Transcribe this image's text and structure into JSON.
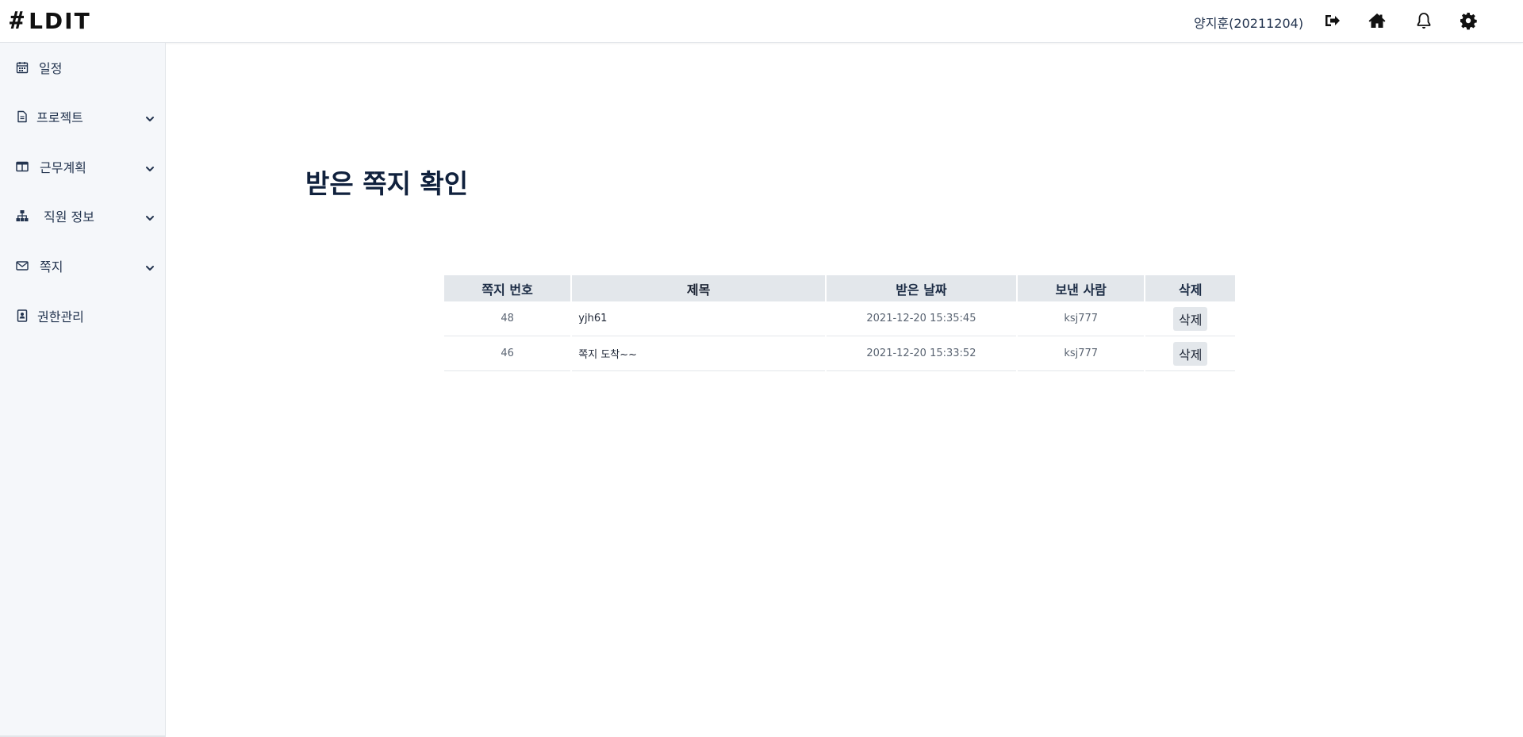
{
  "header": {
    "logo_text": "LDIT",
    "logo_symbol": "#",
    "user_name": "양지훈(20211204)",
    "icons": [
      "logout-icon",
      "home-icon",
      "bell-icon",
      "gear-icon"
    ]
  },
  "sidebar": {
    "items": [
      {
        "label": "일정",
        "icon": "calendar-icon",
        "has_submenu": false
      },
      {
        "label": "프로젝트",
        "icon": "document-icon",
        "has_submenu": true
      },
      {
        "label": "근무계획",
        "icon": "layout-icon",
        "has_submenu": true
      },
      {
        "label": "직원 정보",
        "icon": "org-chart-icon",
        "has_submenu": true
      },
      {
        "label": "쪽지",
        "icon": "envelope-icon",
        "has_submenu": true
      },
      {
        "label": "권한관리",
        "icon": "id-badge-icon",
        "has_submenu": false
      }
    ]
  },
  "main": {
    "title": "받은 쪽지 확인",
    "table": {
      "headers": [
        "쪽지 번호",
        "제목",
        "받은 날짜",
        "보낸 사람",
        "삭제"
      ],
      "rows": [
        {
          "no": "48",
          "title": "yjh61",
          "date": "2021-12-20 15:35:45",
          "sender": "ksj777",
          "delete_label": "삭제"
        },
        {
          "no": "46",
          "title": "쪽지 도착~~",
          "date": "2021-12-20 15:33:52",
          "sender": "ksj777",
          "delete_label": "삭제"
        }
      ]
    }
  },
  "colors": {
    "header_bg": "#ffffff",
    "sidebar_bg": "#f5f7fa",
    "table_header_bg": "#e3e7eb",
    "text_dark": "#10213d"
  }
}
